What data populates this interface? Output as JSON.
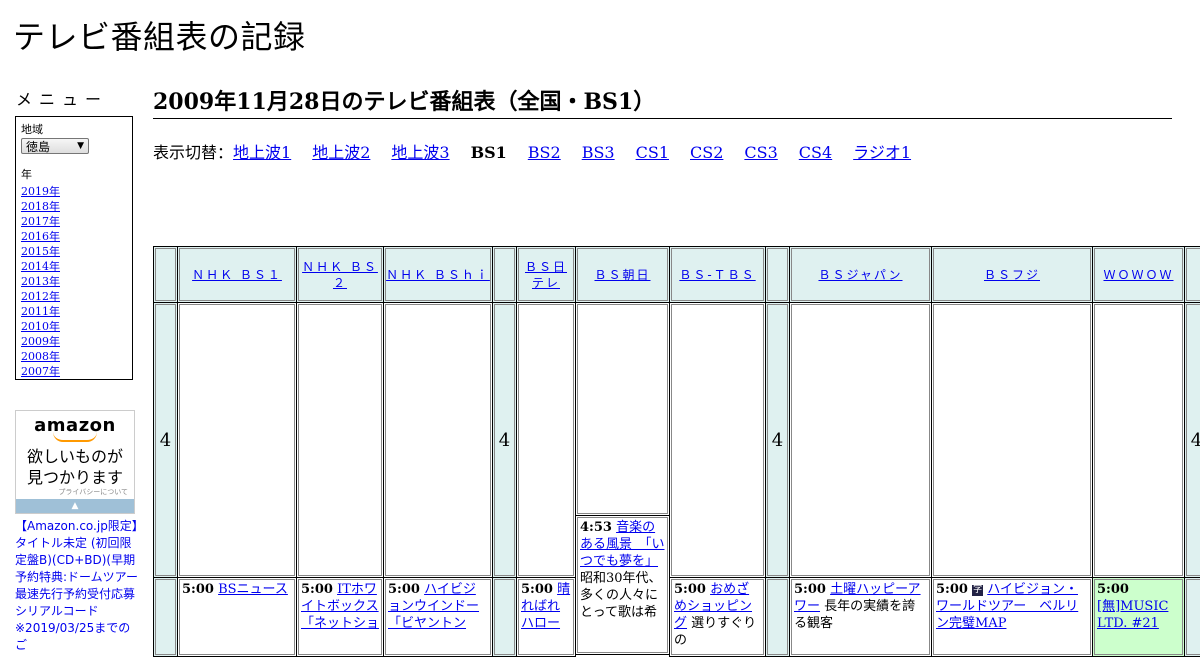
{
  "site": {
    "title": "テレビ番組表の記録"
  },
  "sidebar": {
    "menu_heading": "メニュー",
    "region_label": "地域",
    "region_value": "徳島",
    "year_label": "年",
    "years": [
      "2019年",
      "2018年",
      "2017年",
      "2016年",
      "2015年",
      "2014年",
      "2013年",
      "2012年",
      "2011年",
      "2010年",
      "2009年",
      "2008年",
      "2007年"
    ],
    "ad": {
      "logo": "amazon",
      "copy_line1": "欲しいものが",
      "copy_line2": "見つかります",
      "privacy": "プライバシーについて",
      "arrow": "▲",
      "product_text": "【Amazon.co.jp限定】タイトル未定 (初回限定盤B)(CD+BD)(早期予約特典:ドームツアー最速先行予約受付応募シリアルコード",
      "note": "※2019/03/25までのご"
    }
  },
  "main": {
    "title": "2009年11月28日のテレビ番組表（全国・BS1）",
    "switch_label": "表示切替：",
    "switch_items": [
      {
        "label": "地上波1",
        "current": false
      },
      {
        "label": "地上波2",
        "current": false
      },
      {
        "label": "地上波3",
        "current": false
      },
      {
        "label": "BS1",
        "current": true
      },
      {
        "label": "BS2",
        "current": false
      },
      {
        "label": "BS3",
        "current": false
      },
      {
        "label": "CS1",
        "current": false
      },
      {
        "label": "CS2",
        "current": false
      },
      {
        "label": "CS3",
        "current": false
      },
      {
        "label": "CS4",
        "current": false
      },
      {
        "label": "ラジオ1",
        "current": false
      }
    ]
  },
  "grid": {
    "hour": "4",
    "channels": [
      "ＮＨＫ ＢＳ１",
      "ＮＨＫ ＢＳ２",
      "ＮＨＫ ＢＳｈｉ",
      "ＢＳ日テレ",
      "ＢＳ朝日",
      "ＢＳ-ＴＢＳ",
      "ＢＳジャパン",
      "ＢＳフジ",
      "ＷＯＷＯＷ"
    ],
    "programs": {
      "bsasahi_453": {
        "time": "4:53",
        "title": "音楽のある風景　「いつでも夢を」",
        "desc": "昭和30年代、多くの人々にとって歌は希"
      },
      "bs1_500": {
        "time": "5:00",
        "title": "BSニュース"
      },
      "bs2_500": {
        "time": "5:00",
        "title": "ITホワイトボックス「ネットショ"
      },
      "bshi_500": {
        "time": "5:00",
        "title": "ハイビジョンウインドー「ビヤントン"
      },
      "bsntv_500": {
        "time": "5:00",
        "title": "晴ればれハロー"
      },
      "bstbs_500": {
        "time": "5:00",
        "title": "おめざめショッピング",
        "desc": "選りすぐりの"
      },
      "bsjapan_500": {
        "time": "5:00",
        "title": "土曜ハッピーアワー",
        "desc": "長年の実績を誇る観客"
      },
      "bsfuji_500": {
        "time": "5:00",
        "icon": "字",
        "title": "ハイビジョン・ワールドツアー　ベルリン完璧MAP"
      },
      "wowow_500": {
        "time": "5:00",
        "title": "[無]MUSIC LTD. #21"
      }
    }
  }
}
